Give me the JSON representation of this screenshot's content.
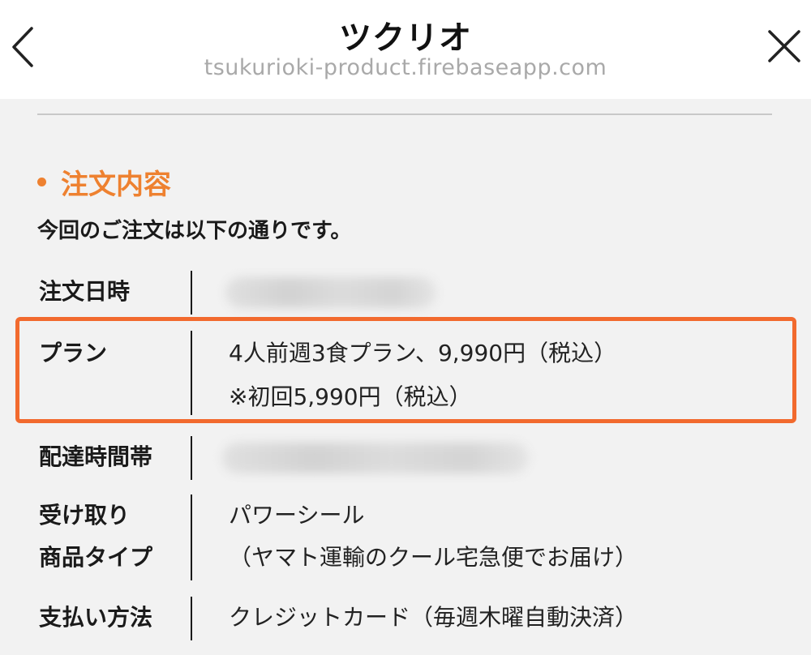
{
  "header": {
    "title": "ツクリオ",
    "url": "tsukurioki-product.firebaseapp.com",
    "back_icon": "chevron-left-icon",
    "close_icon": "close-icon"
  },
  "section": {
    "heading": "注文内容",
    "subtitle": "今回のご注文は以下の通りです。"
  },
  "order": {
    "date_label": "注文日時",
    "plan_label": "プラン",
    "plan_line1": "4人前週3食プラン、9,990円（税込）",
    "plan_line2": "※初回5,990円（税込）",
    "delivery_label": "配達時間帯",
    "receive_label_line1": "受け取り",
    "receive_label_line2": "商品タイプ",
    "receive_line1": "パワーシール",
    "receive_line2": "（ヤマト運輸のクール宅急便でお届け）",
    "payment_label": "支払い方法",
    "payment_value": "クレジットカード（毎週木曜自動決済）"
  },
  "colors": {
    "accent": "#ee8130",
    "highlight_border": "#f26a2e",
    "background": "#f2f2f2",
    "url_text": "#a9a9a9"
  }
}
